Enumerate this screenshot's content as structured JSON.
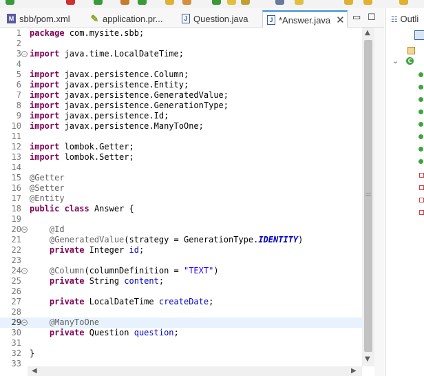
{
  "tabs": [
    {
      "label": "sbb/pom.xml",
      "icon": "maven-file-icon",
      "color": "#5a5aa0"
    },
    {
      "label": "application.pr...",
      "icon": "properties-file-icon",
      "color": "#a0b020"
    },
    {
      "label": "Question.java",
      "icon": "java-file-icon",
      "color": "#3a5a9a"
    },
    {
      "label": "*Answer.java",
      "icon": "java-file-icon",
      "color": "#3a5a9a"
    }
  ],
  "window_controls": {
    "minimize": "▭",
    "maximize": "☐"
  },
  "outline": {
    "title": "Outli"
  },
  "editor": {
    "current_line": 29,
    "lines": [
      {
        "n": "1",
        "segs": [
          {
            "t": "package",
            "c": "kw"
          },
          {
            "t": " com.mysite.sbb;"
          }
        ]
      },
      {
        "n": "2",
        "segs": []
      },
      {
        "n": "3",
        "fold": true,
        "segs": [
          {
            "t": "import",
            "c": "kw"
          },
          {
            "t": " java.time.LocalDateTime;"
          }
        ]
      },
      {
        "n": "4",
        "segs": []
      },
      {
        "n": "5",
        "segs": [
          {
            "t": "import",
            "c": "kw"
          },
          {
            "t": " javax.persistence.Column;"
          }
        ]
      },
      {
        "n": "6",
        "segs": [
          {
            "t": "import",
            "c": "kw"
          },
          {
            "t": " javax.persistence.Entity;"
          }
        ]
      },
      {
        "n": "7",
        "segs": [
          {
            "t": "import",
            "c": "kw"
          },
          {
            "t": " javax.persistence.GeneratedValue;"
          }
        ]
      },
      {
        "n": "8",
        "segs": [
          {
            "t": "import",
            "c": "kw"
          },
          {
            "t": " javax.persistence.GenerationType;"
          }
        ]
      },
      {
        "n": "9",
        "segs": [
          {
            "t": "import",
            "c": "kw"
          },
          {
            "t": " javax.persistence.Id;"
          }
        ]
      },
      {
        "n": "10",
        "segs": [
          {
            "t": "import",
            "c": "kw"
          },
          {
            "t": " javax.persistence.ManyToOne;"
          }
        ]
      },
      {
        "n": "11",
        "segs": []
      },
      {
        "n": "12",
        "segs": [
          {
            "t": "import",
            "c": "kw"
          },
          {
            "t": " lombok.Getter;"
          }
        ]
      },
      {
        "n": "13",
        "segs": [
          {
            "t": "import",
            "c": "kw"
          },
          {
            "t": " lombok.Setter;"
          }
        ]
      },
      {
        "n": "14",
        "segs": []
      },
      {
        "n": "15",
        "segs": [
          {
            "t": "@Getter",
            "c": "ann"
          }
        ]
      },
      {
        "n": "16",
        "segs": [
          {
            "t": "@Setter",
            "c": "ann"
          }
        ]
      },
      {
        "n": "17",
        "segs": [
          {
            "t": "@Entity",
            "c": "ann"
          }
        ]
      },
      {
        "n": "18",
        "segs": [
          {
            "t": "public",
            "c": "kw"
          },
          {
            "t": " "
          },
          {
            "t": "class",
            "c": "kw"
          },
          {
            "t": " Answer {"
          }
        ]
      },
      {
        "n": "19",
        "segs": []
      },
      {
        "n": "20",
        "fold": true,
        "segs": [
          {
            "t": "    "
          },
          {
            "t": "@Id",
            "c": "ann"
          }
        ]
      },
      {
        "n": "21",
        "segs": [
          {
            "t": "    "
          },
          {
            "t": "@GeneratedValue",
            "c": "ann"
          },
          {
            "t": "(strategy = GenerationType."
          },
          {
            "t": "IDENTITY",
            "c": "sfld"
          },
          {
            "t": ")"
          }
        ]
      },
      {
        "n": "22",
        "segs": [
          {
            "t": "    "
          },
          {
            "t": "private",
            "c": "kw"
          },
          {
            "t": " Integer "
          },
          {
            "t": "id",
            "c": "fld"
          },
          {
            "t": ";"
          }
        ]
      },
      {
        "n": "23",
        "segs": []
      },
      {
        "n": "24",
        "fold": true,
        "segs": [
          {
            "t": "    "
          },
          {
            "t": "@Column",
            "c": "ann"
          },
          {
            "t": "(columnDefinition = "
          },
          {
            "t": "\"TEXT\"",
            "c": "str"
          },
          {
            "t": ")"
          }
        ]
      },
      {
        "n": "25",
        "segs": [
          {
            "t": "    "
          },
          {
            "t": "private",
            "c": "kw"
          },
          {
            "t": " String "
          },
          {
            "t": "content",
            "c": "fld"
          },
          {
            "t": ";"
          }
        ]
      },
      {
        "n": "26",
        "segs": []
      },
      {
        "n": "27",
        "segs": [
          {
            "t": "    "
          },
          {
            "t": "private",
            "c": "kw"
          },
          {
            "t": " LocalDateTime "
          },
          {
            "t": "createDate",
            "c": "fld"
          },
          {
            "t": ";"
          }
        ]
      },
      {
        "n": "28",
        "segs": []
      },
      {
        "n": "29",
        "fold": true,
        "segs": [
          {
            "t": "    "
          },
          {
            "t": "@ManyToOne",
            "c": "ann"
          }
        ]
      },
      {
        "n": "30",
        "segs": [
          {
            "t": "    "
          },
          {
            "t": "private",
            "c": "kw"
          },
          {
            "t": " Question "
          },
          {
            "t": "question",
            "c": "fld"
          },
          {
            "t": ";"
          }
        ]
      },
      {
        "n": "31",
        "segs": []
      },
      {
        "n": "32",
        "segs": [
          {
            "t": "}"
          }
        ]
      },
      {
        "n": "33",
        "segs": []
      }
    ]
  },
  "colors": {
    "accent": "#3b8eda",
    "keyword": "#7f0055",
    "annotation": "#646464",
    "field": "#0000c0",
    "string": "#2a00ff"
  }
}
